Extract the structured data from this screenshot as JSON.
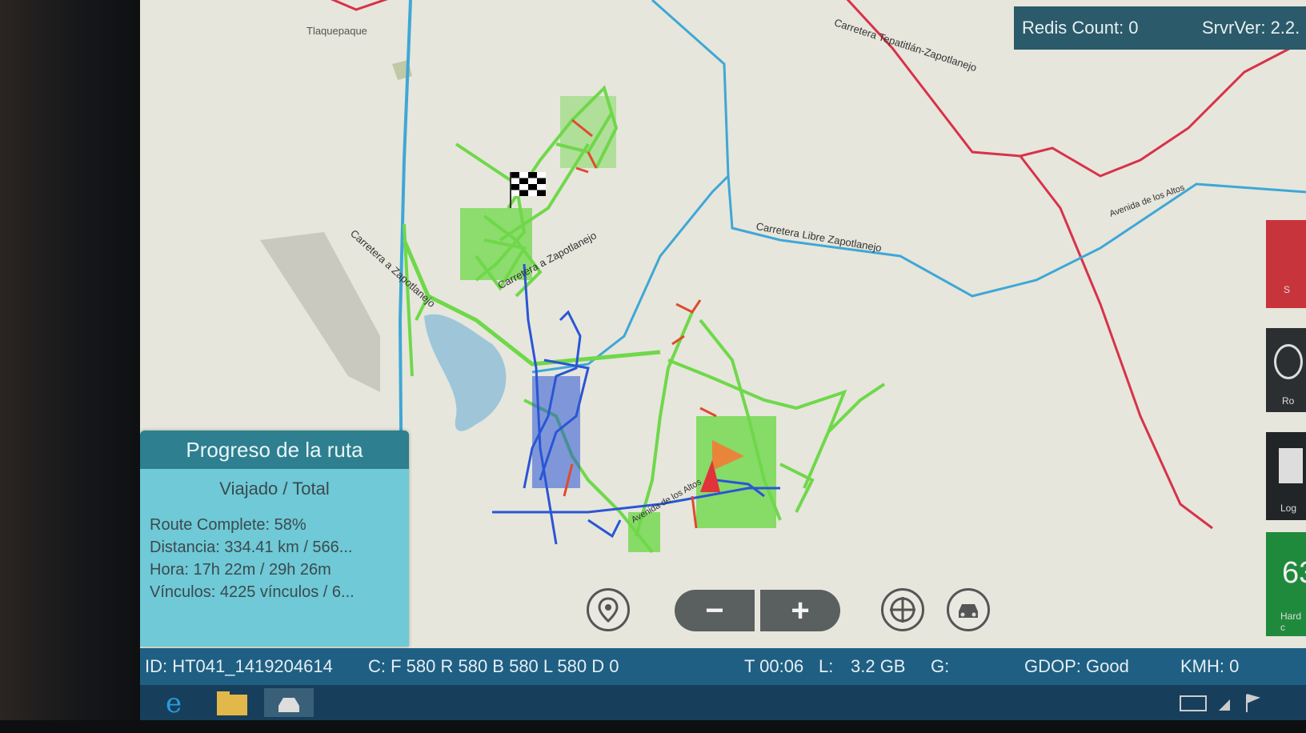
{
  "map": {
    "places": [
      "Tlaquepaque"
    ],
    "roads": [
      "Carretera Tepatitlán-Zapotlanejo",
      "Carretera a Zapotlanejo",
      "Carretera a Zapotlanejo",
      "Carretera Libre Zapotlanejo",
      "Avenida de los Altos",
      "Avenida de los Altos"
    ]
  },
  "topbar": {
    "redis_count": "Redis Count: 0",
    "srv_ver": "SrvrVer: 2.2."
  },
  "route_progress": {
    "title": "Progreso de la ruta",
    "subtitle": "Viajado / Total",
    "route_complete": "Route Complete: 58%",
    "distance": "Distancia: 334.41 km / 566...",
    "time": "Hora: 17h 22m / 29h 26m",
    "links": "Vínculos: 4225 vínculos / 6...",
    "percent_complete": 58
  },
  "controls": {
    "zoom_out": "−",
    "zoom_in": "+",
    "icons": [
      "location-pin-icon",
      "crosshair-icon",
      "car-recenter-icon"
    ]
  },
  "side_panel": {
    "btn1_label": "S",
    "btn2_label": "Ro",
    "btn3_label": "Log",
    "speed_value": "63",
    "speed_label": "Hard c"
  },
  "status_bar": {
    "id": "ID: HT041_1419204614",
    "counters": "C: F 580 R 580 B 580 L 580 D 0",
    "time": "T 00:06",
    "memory_label": "L:",
    "memory_value": "3.2 GB",
    "g_label": "G:",
    "gdop": "GDOP: Good",
    "kmh": "KMH: 0"
  },
  "colors": {
    "travelled_green": "#6fd84a",
    "pending_blue": "#2a55d6",
    "highway_red": "#d8324a",
    "road_cyan": "#3fa7d6",
    "panel_teal": "#2e7f8f",
    "status_blue": "#1f5f83"
  }
}
